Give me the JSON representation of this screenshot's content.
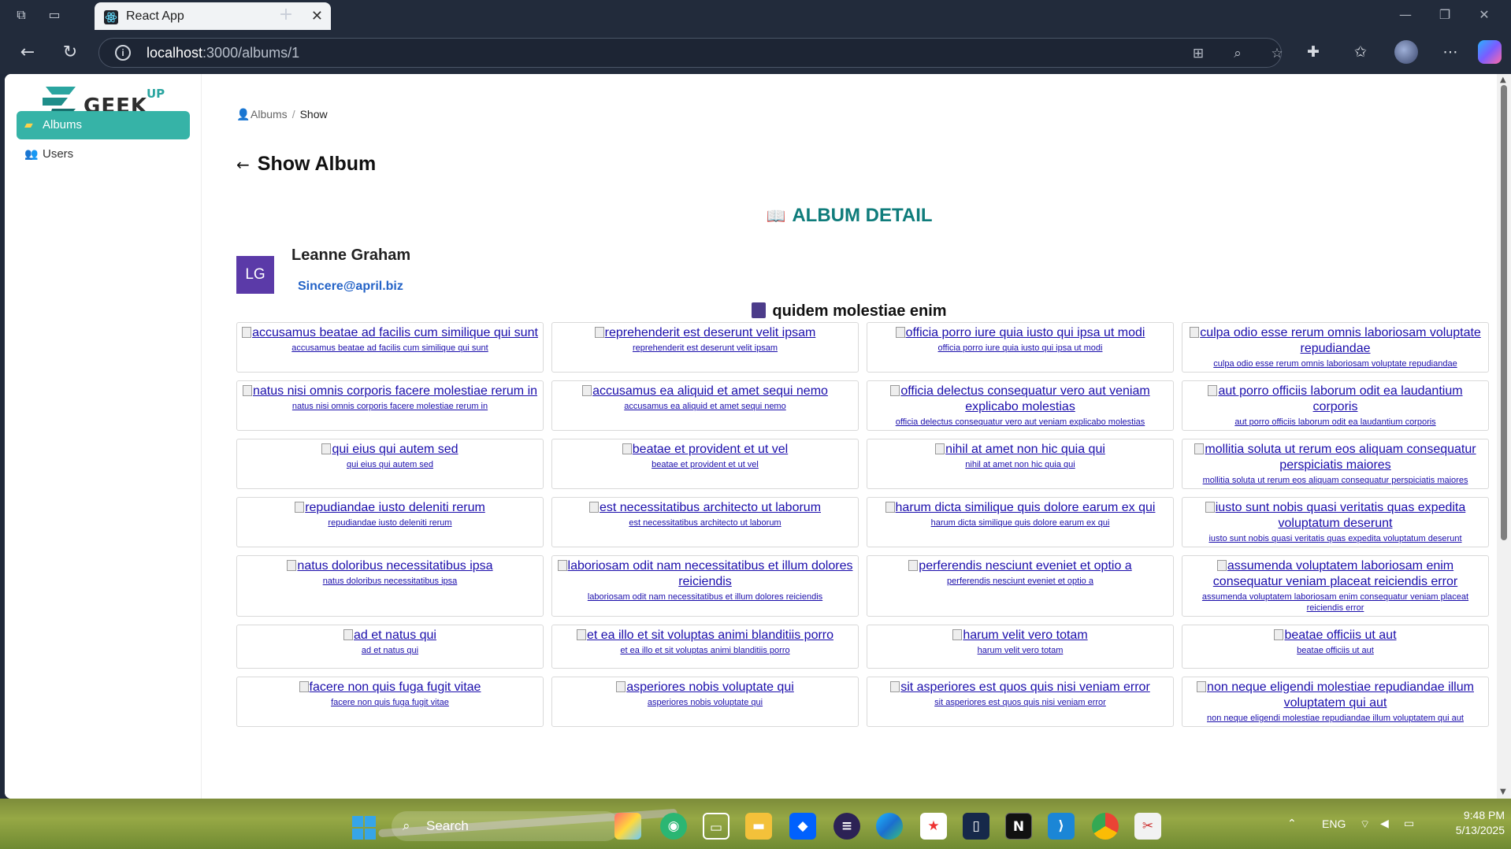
{
  "browser": {
    "tab_title": "React App",
    "url_host": "localhost",
    "url_path": ":3000/albums/1"
  },
  "sidebar": {
    "logo_word": "GEEK",
    "logo_sup": "UP",
    "items": [
      {
        "label": "Albums",
        "icon": "folder-icon",
        "active": true
      },
      {
        "label": "Users",
        "icon": "users-icon",
        "active": false
      }
    ]
  },
  "breadcrumb": {
    "root": "Albums",
    "sep": "/",
    "current": "Show"
  },
  "page_title": "Show Album",
  "detail_heading": "ALBUM DETAIL",
  "user": {
    "initials": "LG",
    "name": "Leanne Graham",
    "email": "Sincere@april.biz"
  },
  "album_title": "quidem molestiae enim",
  "photos": [
    "accusamus beatae ad facilis cum similique qui sunt",
    "reprehenderit est deserunt velit ipsam",
    "officia porro iure quia iusto qui ipsa ut modi",
    "culpa odio esse rerum omnis laboriosam voluptate repudiandae",
    "natus nisi omnis corporis facere molestiae rerum in",
    "accusamus ea aliquid et amet sequi nemo",
    "officia delectus consequatur vero aut veniam explicabo molestias",
    "aut porro officiis laborum odit ea laudantium corporis",
    "qui eius qui autem sed",
    "beatae et provident et ut vel",
    "nihil at amet non hic quia qui",
    "mollitia soluta ut rerum eos aliquam consequatur perspiciatis maiores",
    "repudiandae iusto deleniti rerum",
    "est necessitatibus architecto ut laborum",
    "harum dicta similique quis dolore earum ex qui",
    "iusto sunt nobis quasi veritatis quas expedita voluptatum deserunt",
    "natus doloribus necessitatibus ipsa",
    "laboriosam odit nam necessitatibus et illum dolores reiciendis",
    "perferendis nesciunt eveniet et optio a",
    "assumenda voluptatem laboriosam enim consequatur veniam placeat reiciendis error",
    "ad et natus qui",
    "et ea illo et sit voluptas animi blanditiis porro",
    "harum velit vero totam",
    "beatae officiis ut aut",
    "facere non quis fuga fugit vitae",
    "asperiores nobis voluptate qui",
    "sit asperiores est quos quis nisi veniam error",
    "non neque eligendi molestiae repudiandae illum voluptatem qui aut"
  ],
  "taskbar": {
    "search_placeholder": "Search",
    "lang": "ENG",
    "time": "9:48 PM",
    "date": "5/13/2025"
  },
  "colors": {
    "accent": "#36b3a7",
    "heading": "#0f7c7b",
    "avatar": "#5b3aa8",
    "link": "#1a0dab"
  }
}
